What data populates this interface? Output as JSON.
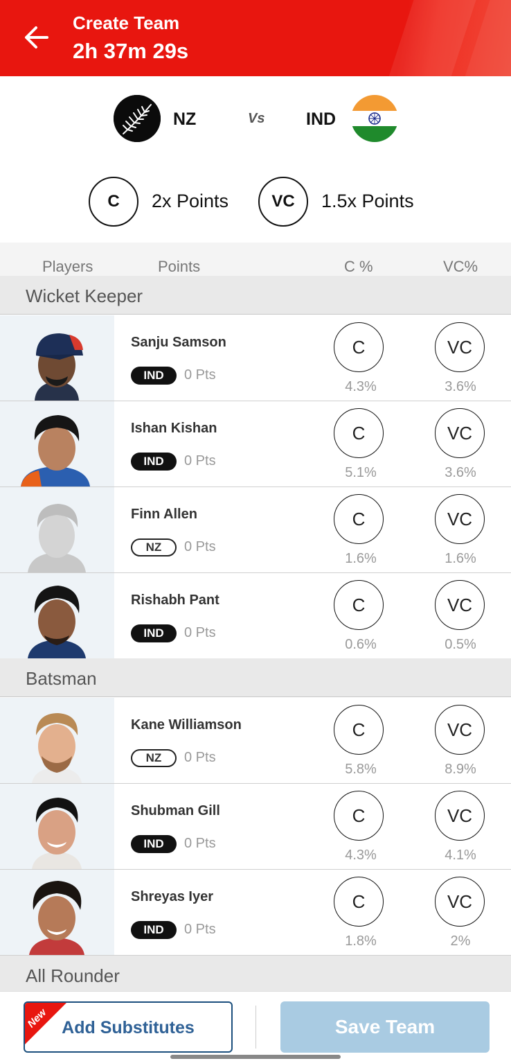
{
  "header": {
    "title": "Create Team",
    "timer": "2h 37m 29s",
    "bg_color": "#e8160f"
  },
  "match": {
    "team1": {
      "name": "NZ"
    },
    "vs_label": "Vs",
    "team2": {
      "name": "IND"
    }
  },
  "legend": {
    "captain": {
      "badge": "C",
      "text": "2x Points"
    },
    "vice_captain": {
      "badge": "VC",
      "text": "1.5x Points"
    }
  },
  "columns": {
    "players": "Players",
    "points": "Points",
    "c_pct": "C %",
    "vc_pct": "VC%"
  },
  "sections": [
    {
      "title": "Wicket Keeper",
      "players": [
        {
          "name": "Sanju Samson",
          "team": "IND",
          "points": "0 Pts",
          "c_label": "C",
          "vc_label": "VC",
          "c_pct": "4.3%",
          "vc_pct": "3.6%"
        },
        {
          "name": "Ishan Kishan",
          "team": "IND",
          "points": "0 Pts",
          "c_label": "C",
          "vc_label": "VC",
          "c_pct": "5.1%",
          "vc_pct": "3.6%"
        },
        {
          "name": "Finn Allen",
          "team": "NZ",
          "points": "0 Pts",
          "c_label": "C",
          "vc_label": "VC",
          "c_pct": "1.6%",
          "vc_pct": "1.6%"
        },
        {
          "name": "Rishabh Pant",
          "team": "IND",
          "points": "0 Pts",
          "c_label": "C",
          "vc_label": "VC",
          "c_pct": "0.6%",
          "vc_pct": "0.5%"
        }
      ]
    },
    {
      "title": "Batsman",
      "players": [
        {
          "name": "Kane Williamson",
          "team": "NZ",
          "points": "0 Pts",
          "c_label": "C",
          "vc_label": "VC",
          "c_pct": "5.8%",
          "vc_pct": "8.9%"
        },
        {
          "name": "Shubman Gill",
          "team": "IND",
          "points": "0 Pts",
          "c_label": "C",
          "vc_label": "VC",
          "c_pct": "4.3%",
          "vc_pct": "4.1%"
        },
        {
          "name": "Shreyas Iyer",
          "team": "IND",
          "points": "0 Pts",
          "c_label": "C",
          "vc_label": "VC",
          "c_pct": "1.8%",
          "vc_pct": "2%"
        }
      ]
    },
    {
      "title": "All Rounder",
      "players": []
    }
  ],
  "footer": {
    "new_tag": "New",
    "add_substitutes": "Add Substitutes",
    "save_team": "Save Team"
  }
}
